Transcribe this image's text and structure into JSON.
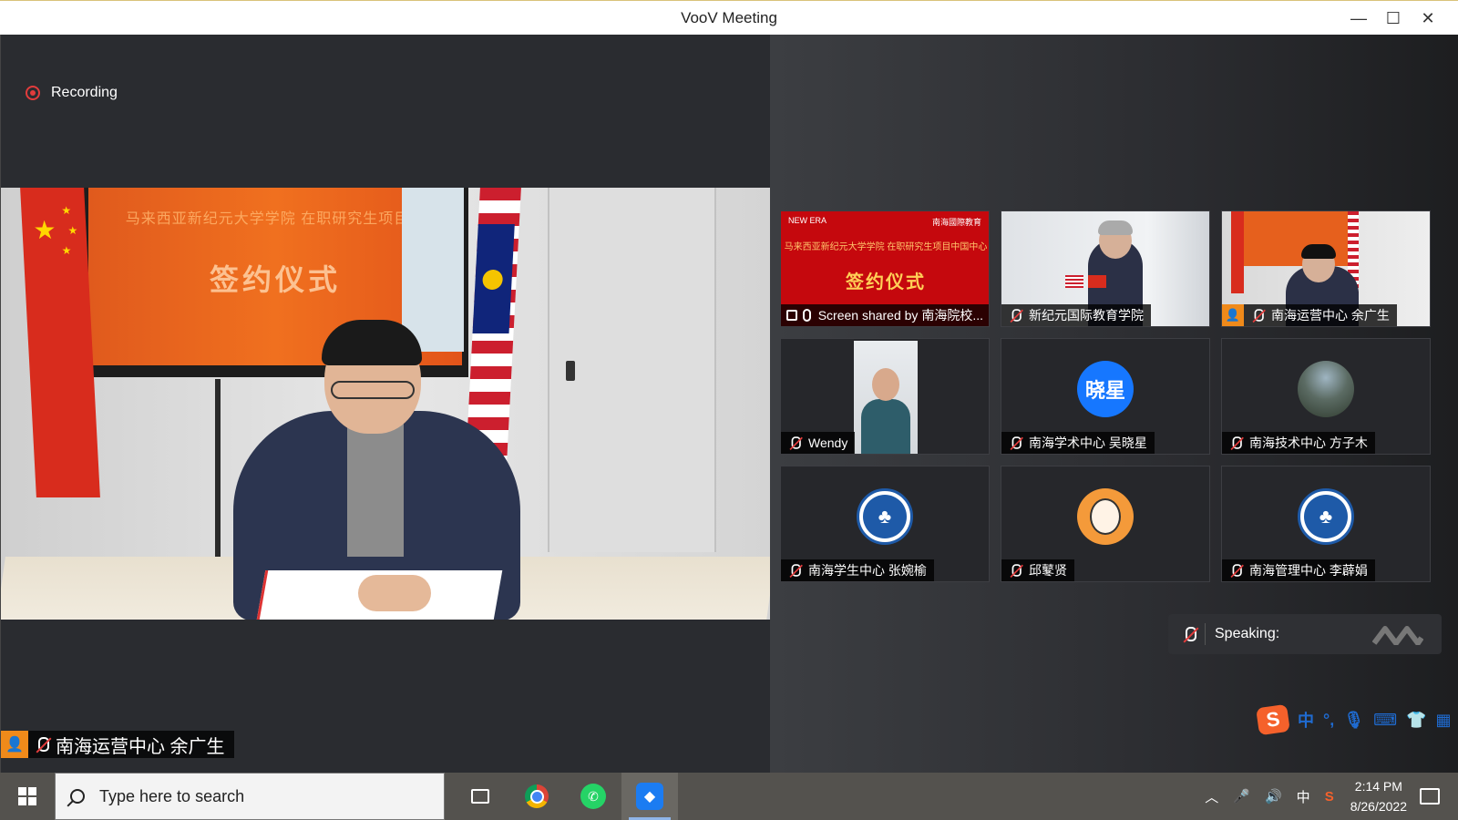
{
  "window": {
    "title": "VooV Meeting",
    "minimize_icon": "minimize-icon",
    "maximize_icon": "maximize-icon",
    "close_icon": "close-icon",
    "minimize_glyph": "—",
    "maximize_glyph": "☐",
    "close_glyph": "✕"
  },
  "recording": {
    "label": "Recording",
    "color": "#e23c3c"
  },
  "main_video": {
    "screen_heading": "马来西亚新纪元大学学院 在职研究生项目中",
    "screen_title": "签约仪式",
    "participant_name": "南海运营中心 余广生"
  },
  "tiles": [
    {
      "label": "Screen shared by 南海院校...",
      "slide_title": "签约仪式",
      "slide_subtitle": "马来西亚新纪元大学学院 在职研究生项目中国中心",
      "slide_logo_left": "NEW ERA",
      "slide_logo_right": "南海國際教育"
    },
    {
      "label": "新纪元国际教育学院"
    },
    {
      "label": "南海运营中心 余广生"
    },
    {
      "label": "Wendy"
    },
    {
      "label": "南海学术中心 吴晓星",
      "avatar_text": "晓星"
    },
    {
      "label": "南海技术中心 方子木"
    },
    {
      "label": "南海学生中心 张婉榆"
    },
    {
      "label": "邱鼕贤"
    },
    {
      "label": "南海管理中心 李薜娟"
    }
  ],
  "speaking": {
    "label": "Speaking:"
  },
  "ime": {
    "logo": "S",
    "mode": "中",
    "punct": "°,"
  },
  "taskbar": {
    "search_placeholder": "Type here to search",
    "apps": [
      "task-view",
      "chrome",
      "whatsapp",
      "voov-meeting"
    ],
    "tray_lang": "中",
    "time": "2:14 PM",
    "date": "8/26/2022"
  },
  "colors": {
    "accent_blue": "#1677ff",
    "host_orange": "#f08a1a",
    "taskbar": "#54524e"
  }
}
